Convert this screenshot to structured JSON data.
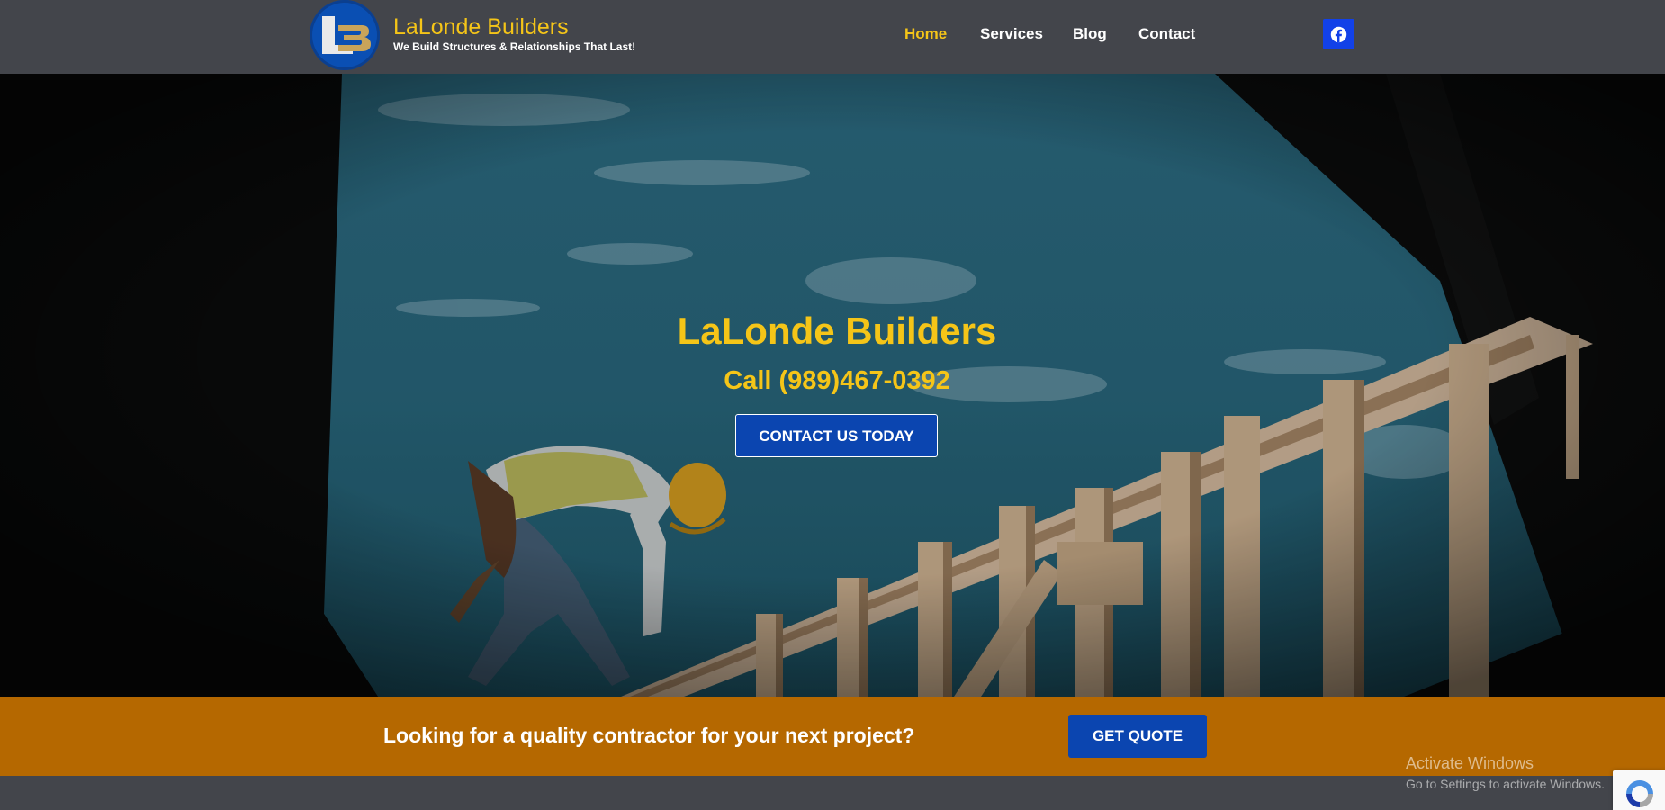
{
  "brand": {
    "logo_text": "LB",
    "title": "LaLonde Builders",
    "tagline": "We Build Structures & Relationships That Last!"
  },
  "nav": [
    {
      "label": "Home",
      "active": true
    },
    {
      "label": "Services",
      "active": false
    },
    {
      "label": "Blog",
      "active": false
    },
    {
      "label": "Contact",
      "active": false
    }
  ],
  "social": {
    "icon": "facebook-icon",
    "color": "#1241e8"
  },
  "hero": {
    "title": "LaLonde Builders",
    "phone": "Call (989)467-0392",
    "cta_label": "CONTACT US TODAY"
  },
  "band": {
    "text": "Looking for a quality contractor for your next project?",
    "button_label": "GET QUOTE",
    "color": "#b56800"
  },
  "watermark": {
    "line1": "Activate Windows",
    "line2": "Go to Settings to activate Windows."
  },
  "colors": {
    "accent_yellow": "#f5c518",
    "button_blue": "#0b45b0",
    "header_bg": "#43454b"
  }
}
